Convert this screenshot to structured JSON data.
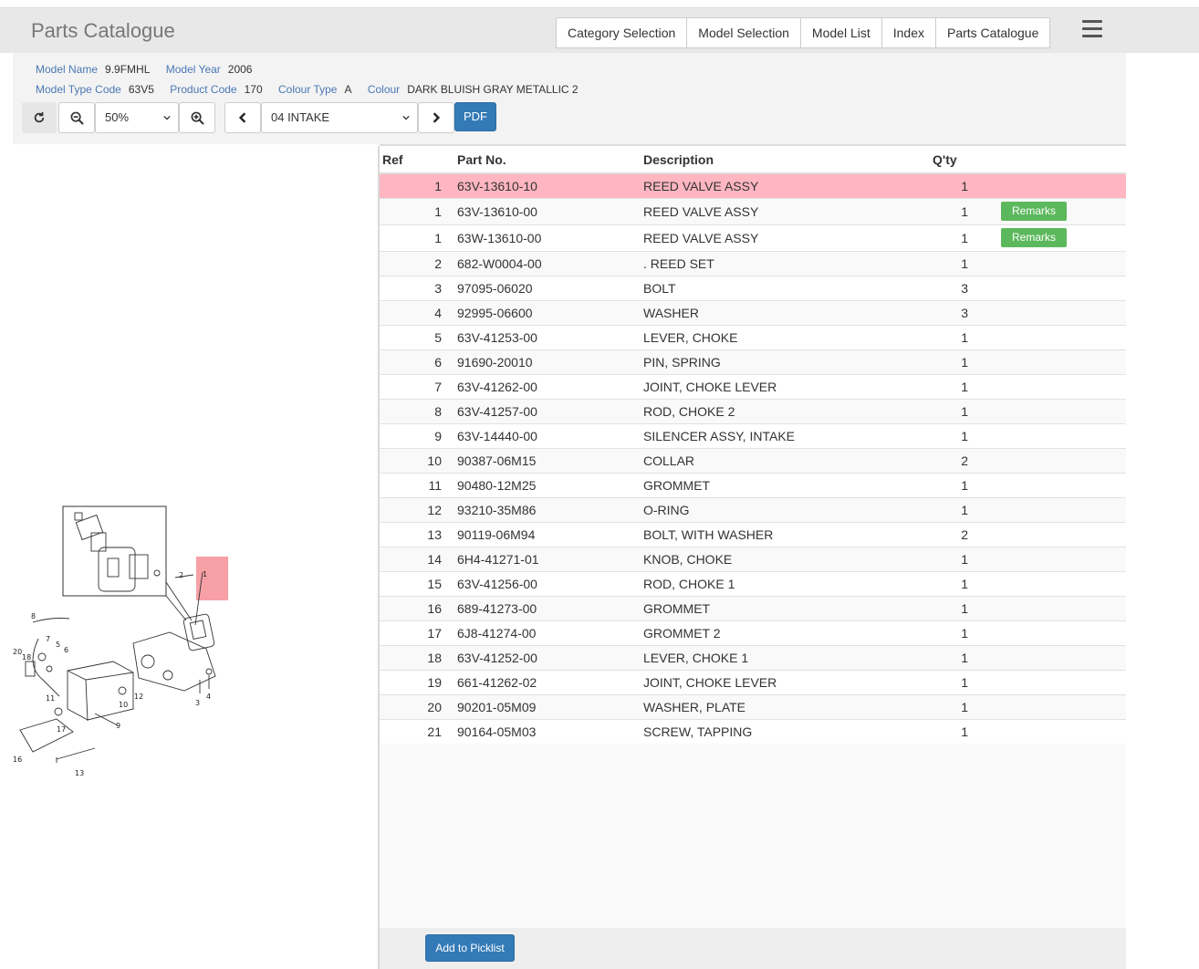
{
  "app": {
    "title": "Parts Catalogue"
  },
  "nav": [
    "Category Selection",
    "Model Selection",
    "Model List",
    "Index",
    "Parts Catalogue"
  ],
  "info": {
    "model_name_label": "Model Name",
    "model_name": "9.9FMHL",
    "model_year_label": "Model Year",
    "model_year": "2006",
    "model_type_code_label": "Model Type Code",
    "model_type_code": "63V5",
    "product_code_label": "Product Code",
    "product_code": "170",
    "colour_type_label": "Colour Type",
    "colour_type": "A",
    "colour_label": "Colour",
    "colour": "DARK BLUISH GRAY METALLIC 2"
  },
  "toolbar": {
    "zoom": "50%",
    "section": "04 INTAKE",
    "pdf": "PDF"
  },
  "table": {
    "headers": {
      "ref": "Ref",
      "part": "Part No.",
      "desc": "Description",
      "qty": "Q'ty"
    },
    "remarks_label": "Remarks",
    "rows": [
      {
        "ref": "1",
        "part": "63V-13610-10",
        "desc": "REED VALVE ASSY",
        "qty": "1",
        "selected": true,
        "remarks": false
      },
      {
        "ref": "1",
        "part": "63V-13610-00",
        "desc": "REED VALVE ASSY",
        "qty": "1",
        "remarks": true
      },
      {
        "ref": "1",
        "part": "63W-13610-00",
        "desc": "REED VALVE ASSY",
        "qty": "1",
        "remarks": true
      },
      {
        "ref": "2",
        "part": "682-W0004-00",
        "desc": ". REED SET",
        "qty": "1"
      },
      {
        "ref": "3",
        "part": "97095-06020",
        "desc": "BOLT",
        "qty": "3"
      },
      {
        "ref": "4",
        "part": "92995-06600",
        "desc": "WASHER",
        "qty": "3"
      },
      {
        "ref": "5",
        "part": "63V-41253-00",
        "desc": "LEVER, CHOKE",
        "qty": "1"
      },
      {
        "ref": "6",
        "part": "91690-20010",
        "desc": "PIN, SPRING",
        "qty": "1"
      },
      {
        "ref": "7",
        "part": "63V-41262-00",
        "desc": "JOINT, CHOKE LEVER",
        "qty": "1"
      },
      {
        "ref": "8",
        "part": "63V-41257-00",
        "desc": "ROD, CHOKE 2",
        "qty": "1"
      },
      {
        "ref": "9",
        "part": "63V-14440-00",
        "desc": "SILENCER ASSY, INTAKE",
        "qty": "1"
      },
      {
        "ref": "10",
        "part": "90387-06M15",
        "desc": "COLLAR",
        "qty": "2"
      },
      {
        "ref": "11",
        "part": "90480-12M25",
        "desc": "GROMMET",
        "qty": "1"
      },
      {
        "ref": "12",
        "part": "93210-35M86",
        "desc": "O-RING",
        "qty": "1"
      },
      {
        "ref": "13",
        "part": "90119-06M94",
        "desc": "BOLT, WITH WASHER",
        "qty": "2"
      },
      {
        "ref": "14",
        "part": "6H4-41271-01",
        "desc": "KNOB, CHOKE",
        "qty": "1"
      },
      {
        "ref": "15",
        "part": "63V-41256-00",
        "desc": "ROD, CHOKE 1",
        "qty": "1"
      },
      {
        "ref": "16",
        "part": "689-41273-00",
        "desc": "GROMMET",
        "qty": "1"
      },
      {
        "ref": "17",
        "part": "6J8-41274-00",
        "desc": "GROMMET 2",
        "qty": "1"
      },
      {
        "ref": "18",
        "part": "63V-41252-00",
        "desc": "LEVER, CHOKE 1",
        "qty": "1"
      },
      {
        "ref": "19",
        "part": "661-41262-02",
        "desc": "JOINT, CHOKE LEVER",
        "qty": "1"
      },
      {
        "ref": "20",
        "part": "90201-05M09",
        "desc": "WASHER, PLATE",
        "qty": "1"
      },
      {
        "ref": "21",
        "part": "90164-05M03",
        "desc": "SCREW, TAPPING",
        "qty": "1"
      }
    ]
  },
  "diagram_labels": [
    "1",
    "2",
    "3",
    "4",
    "5",
    "6",
    "7",
    "8",
    "9",
    "10",
    "11",
    "12",
    "13",
    "16",
    "17",
    "18",
    "20"
  ],
  "footer": {
    "add_to_picklist": "Add to Picklist"
  },
  "colors": {
    "selected_row": "#ffb6c1",
    "primary": "#337ab7",
    "success": "#5cb85c",
    "highlight_box": "#f7a0a5"
  }
}
